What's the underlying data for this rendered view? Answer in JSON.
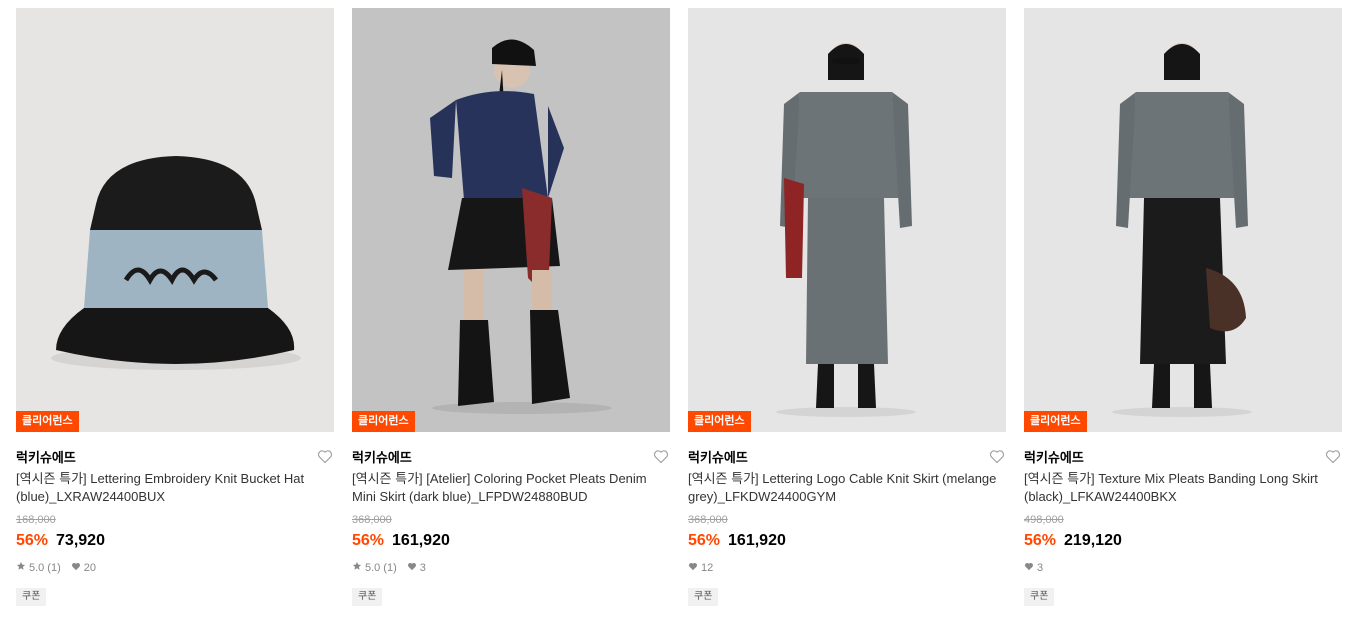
{
  "products": [
    {
      "badge": "클리어런스",
      "brand": "럭키슈에뜨",
      "title": "[역시즌 특가] Lettering Embroidery Knit Bucket Hat (blue)_LXRAW24400BUX",
      "original_price": "168,000",
      "discount": "56%",
      "price": "73,920",
      "rating": "5.0",
      "review_count": "(1)",
      "likes": "20",
      "coupon": "쿠폰"
    },
    {
      "badge": "클리어런스",
      "brand": "럭키슈에뜨",
      "title": "[역시즌 특가] [Atelier] Coloring Pocket Pleats Denim Mini Skirt (dark blue)_LFPDW24880BUD",
      "original_price": "368,000",
      "discount": "56%",
      "price": "161,920",
      "rating": "5.0",
      "review_count": "(1)",
      "likes": "3",
      "coupon": "쿠폰"
    },
    {
      "badge": "클리어런스",
      "brand": "럭키슈에뜨",
      "title": "[역시즌 특가] Lettering Logo Cable Knit Skirt (melange grey)_LFKDW24400GYM",
      "original_price": "368,000",
      "discount": "56%",
      "price": "161,920",
      "likes": "12",
      "coupon": "쿠폰"
    },
    {
      "badge": "클리어런스",
      "brand": "럭키슈에뜨",
      "title": "[역시즌 특가] Texture Mix Pleats Banding Long Skirt (black)_LFKAW24400BKX",
      "original_price": "498,000",
      "discount": "56%",
      "price": "219,120",
      "likes": "3",
      "coupon": "쿠폰"
    }
  ],
  "colors": {
    "accent": "#ff4800",
    "muted": "#888888"
  }
}
